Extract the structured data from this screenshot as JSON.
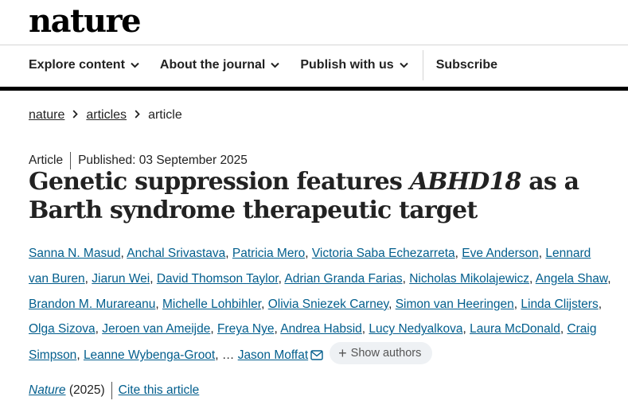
{
  "header": {
    "logo": "nature"
  },
  "nav": {
    "items": [
      {
        "label": "Explore content"
      },
      {
        "label": "About the journal"
      },
      {
        "label": "Publish with us"
      }
    ],
    "subscribe": "Subscribe"
  },
  "breadcrumb": [
    "nature",
    "articles",
    "article"
  ],
  "article": {
    "type": "Article",
    "published": "Published: 03 September 2025",
    "title_part1": "Genetic suppression features ",
    "title_gene": "ABHD18",
    "title_part2": " as a Barth syndrome therapeutic target",
    "authors": [
      "Sanna N. Masud",
      "Anchal Srivastava",
      "Patricia Mero",
      "Victoria Saba Echezarreta",
      "Eve Anderson",
      "Lennard van Buren",
      "Jiarun Wei",
      "David Thomson Taylor",
      "Adrian Granda Farias",
      "Nicholas Mikolajewicz",
      "Angela Shaw",
      "Brandon M. Murareanu",
      "Michelle Lohbihler",
      "Olivia Sniezek Carney",
      "Simon van Heeringen",
      "Linda Clijsters",
      "Olga Sizova",
      "Jeroen van Ameijde",
      "Freya Nye",
      "Andrea Habsid",
      "Lucy Nedyalkova",
      "Laura McDonald",
      "Craig Simpson",
      "Leanne Wybenga-Groot"
    ],
    "ellipsis": "…",
    "last_author": "Jason Moffat",
    "show_authors": "Show authors",
    "journal": "Nature",
    "year": "(2025)",
    "cite": "Cite this article"
  }
}
